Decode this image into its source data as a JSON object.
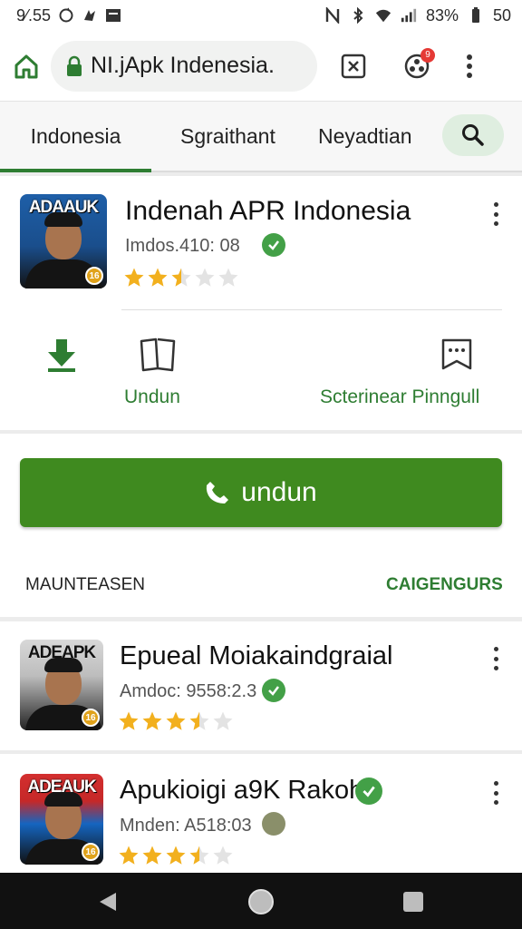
{
  "status_bar": {
    "time": "9⁄.55",
    "battery_text": "83%",
    "signal_text": "50"
  },
  "browser": {
    "url": "NI.jApk Indenesia.",
    "notification_count": "9"
  },
  "tabs": [
    {
      "label": "Indonesia",
      "active": true
    },
    {
      "label": "Sgraithant",
      "active": false
    },
    {
      "label": "Neyadtian",
      "active": false
    }
  ],
  "featured_app": {
    "title": "Indenah APR Indonesia",
    "meta": "Imdos.410: 08",
    "rating": 2.5,
    "avatar_text": "ADAAUK",
    "badge_text": "16",
    "actions": [
      {
        "label": "Undun",
        "icon": "book-icon"
      },
      {
        "label": "Scterinear Pinngull",
        "icon": "message-icon"
      }
    ],
    "download_icon": "download-arrow-icon"
  },
  "primary_button": {
    "label": "undun",
    "icon": "phone-icon"
  },
  "section": {
    "left_label": "MAUNTEASEN",
    "right_label": "CAIGENGURS"
  },
  "list_apps": [
    {
      "title": "Epueal Moiakaindgraial",
      "meta": "Amdoc: 9558:2.3",
      "rating": 3.5,
      "avatar_text": "ADEAPK",
      "badge_text": "16",
      "status_icon": "verified-check-icon"
    },
    {
      "title": "Apukioigi a9K Rakoh",
      "meta": "Mnden: A518:03",
      "rating": 3.5,
      "avatar_text": "ADEAUK",
      "badge_text": "16",
      "status_icon": "verified-check-icon"
    }
  ],
  "colors": {
    "accent": "#2e7d32",
    "primary_button": "#3f8a1f",
    "star": "#f2b01e",
    "verified": "#43a047"
  }
}
